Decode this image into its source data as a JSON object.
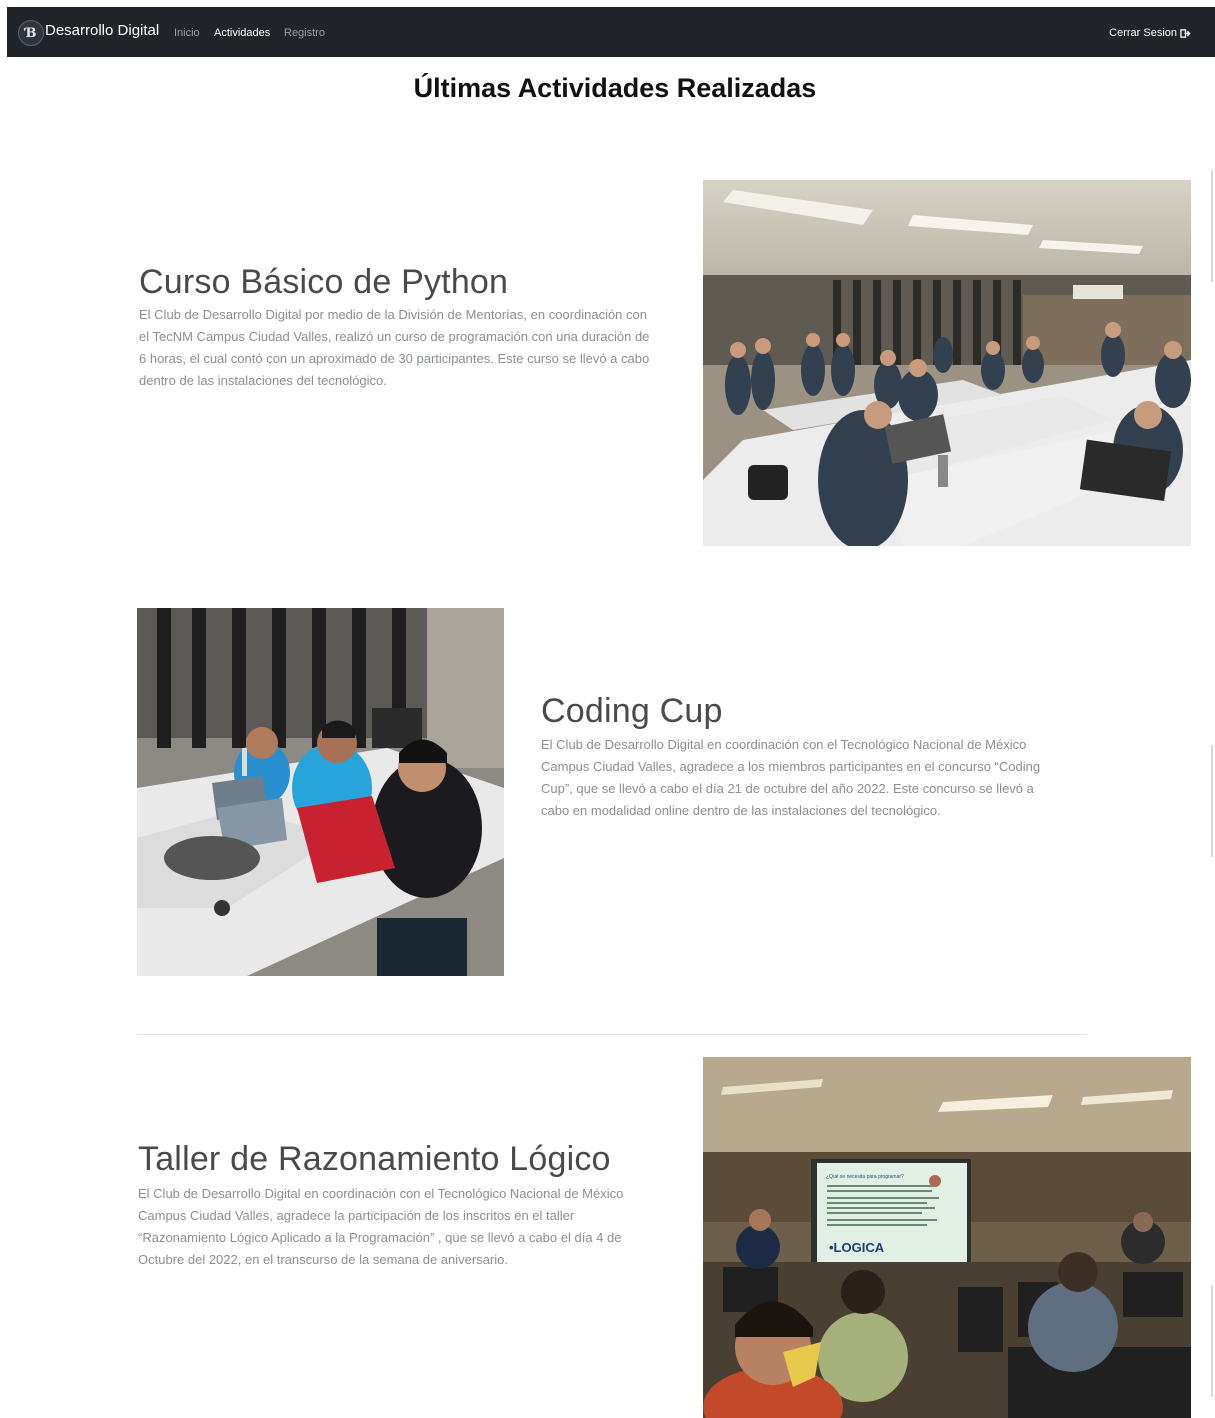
{
  "navbar": {
    "brand_name": "Desarrollo Digital",
    "brand_logo": "DD-monogram-logo",
    "links": [
      {
        "label": "Inicio",
        "active": false
      },
      {
        "label": "Actividades",
        "active": true
      },
      {
        "label": "Registro",
        "active": false
      }
    ],
    "logout_label": "Cerrar Sesion",
    "logout_icon": "sign-out-icon"
  },
  "page": {
    "title": "Últimas Actividades Realizadas"
  },
  "features": [
    {
      "title": "Curso Básico de Python",
      "lines": [
        "El Club de Desarrollo Digital por medio de la División de Mentorías, en coordinación con",
        "el TecNM Campus Ciudad Valles, realizó un curso de programación con una duración de",
        "6 horas, el cual contó con un aproximado de 30 participantes. Este curso se llevó a cabo",
        "dentro de las instalaciones del tecnológico."
      ],
      "image": "classroom-students-laptops-photo"
    },
    {
      "title": "Coding Cup",
      "lines": [
        "El Club de Desarrollo Digital en coordinación con el Tecnológico Nacional de México",
        "Campus Ciudad Valles, agradece a los miembros participantes en el concurso “Coding",
        "Cup”, que se llevó a cabo el día 21 de octubre del año 2022. Este concurso se llevó a",
        "cabo en modalidad online dentro de las instalaciones del tecnológico."
      ],
      "image": "students-red-laptop-photo"
    },
    {
      "title": "Taller de Razonamiento Lógico",
      "lines": [
        "El Club de Desarrollo Digital en coordinación con el Tecnológico Nacional de México",
        "Campus Ciudad Valles, agradece la participación de los inscritos en el taller",
        "“Razonamiento Lógico Aplicado a la Programación” , que se llevó a cabo el día 4 de",
        "Octubre del 2022, en el transcurso de la semana de aniversario."
      ],
      "image": "presentation-room-photo",
      "slide_heading": "¿Qué se necesita para programar?",
      "slide_word": "•LOGICA"
    }
  ]
}
